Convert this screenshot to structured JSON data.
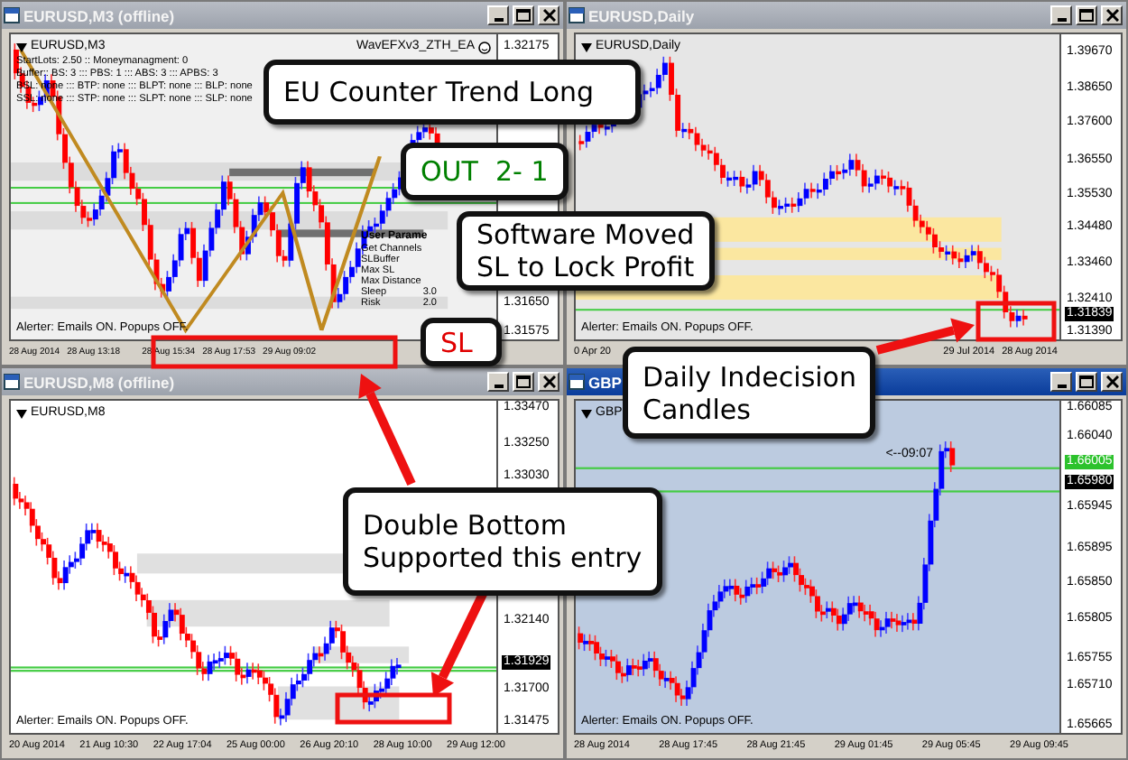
{
  "windows": [
    {
      "title": "EURUSD,M3 (offline)",
      "active": false,
      "kind": "zigzag",
      "symbol": "EURUSD,M3",
      "info_lines": [
        "StartLots: 2.50 :: Moneymanagment: 0",
        "Buffer:: BS: 3 ::: PBS: 1 ::: ABS: 3 ::: APBS: 3",
        "BSL: none ::: BTP: none ::: BLPT: none ::: BLP: none",
        "SSL: none ::: STP: none ::: SLPT: none ::: SLP: none"
      ],
      "ea_label": "WavEFXv3_ZTH_EA",
      "user_params": {
        "title": "User Parame",
        "rows": [
          {
            "label": "Get Channels"
          },
          {
            "label": "SLBuffer"
          },
          {
            "label": "Max SL"
          },
          {
            "label": "Max Distance"
          },
          {
            "label": "Sleep",
            "value": "3.0"
          },
          {
            "label": "Risk",
            "value": "2.0"
          }
        ]
      },
      "alert": "Alerter:  Emails ON.  Popups OFF.",
      "prices": [
        {
          "text": "1.32175",
          "kind": "plain"
        },
        {
          "text": "1.31650",
          "kind": "plain"
        },
        {
          "text": "1.31575",
          "kind": "plain"
        }
      ],
      "times": [
        "28 Aug 2014",
        "28 Aug 13:18",
        "28 Aug 15:34",
        "28 Aug 17:53",
        "29 Aug 09:02"
      ]
    },
    {
      "title": "EURUSD,Daily",
      "active": false,
      "kind": "daily",
      "symbol": "EURUSD,Daily",
      "alert": "Alerter:  Emails ON.  Popups OFF.",
      "prices": [
        {
          "text": "1.39670",
          "kind": "plain"
        },
        {
          "text": "1.38650",
          "kind": "plain"
        },
        {
          "text": "1.37600",
          "kind": "plain"
        },
        {
          "text": "1.36550",
          "kind": "plain"
        },
        {
          "text": "1.35530",
          "kind": "plain"
        },
        {
          "text": "1.34480",
          "kind": "plain"
        },
        {
          "text": "1.33460",
          "kind": "plain"
        },
        {
          "text": "1.32410",
          "kind": "plain"
        },
        {
          "text": "1.31839",
          "kind": "current"
        },
        {
          "text": "1.31390",
          "kind": "plain"
        }
      ],
      "times": [
        "0 Apr 20",
        "29 Jul 2014",
        "28 Aug 2014"
      ]
    },
    {
      "title": "EURUSD,M8 (offline)",
      "active": false,
      "kind": "renko",
      "symbol": "EURUSD,M8",
      "alert": "Alerter:  Emails ON.  Popups OFF.",
      "prices": [
        {
          "text": "1.33470",
          "kind": "plain"
        },
        {
          "text": "1.33250",
          "kind": "plain"
        },
        {
          "text": "1.33030",
          "kind": "plain"
        },
        {
          "text": "1.32140",
          "kind": "plain"
        },
        {
          "text": "1.31929",
          "kind": "current"
        },
        {
          "text": "1.31700",
          "kind": "plain"
        },
        {
          "text": "1.31475",
          "kind": "plain"
        }
      ],
      "times": [
        "20 Aug 2014",
        "21 Aug 10:30",
        "22 Aug 17:04",
        "25 Aug 00:00",
        "26 Aug 20:10",
        "28 Aug 10:00",
        "29 Aug 12:00"
      ]
    },
    {
      "title": "GBP",
      "active": true,
      "kind": "candles",
      "symbol": "GBP",
      "time_marker": "<--09:07",
      "alert": "Alerter:  Emails ON.  Popups OFF.",
      "prices": [
        {
          "text": "1.66085",
          "kind": "plain"
        },
        {
          "text": "1.66040",
          "kind": "plain"
        },
        {
          "text": "1.66005",
          "kind": "bid"
        },
        {
          "text": "1.65980",
          "kind": "current"
        },
        {
          "text": "1.65945",
          "kind": "plain"
        },
        {
          "text": "1.65895",
          "kind": "plain"
        },
        {
          "text": "1.65850",
          "kind": "plain"
        },
        {
          "text": "1.65805",
          "kind": "plain"
        },
        {
          "text": "1.65755",
          "kind": "plain"
        },
        {
          "text": "1.65710",
          "kind": "plain"
        },
        {
          "text": "1.65665",
          "kind": "plain"
        }
      ],
      "times": [
        "28 Aug 2014",
        "28 Aug 17:45",
        "28 Aug 21:45",
        "29 Aug 01:45",
        "29 Aug 05:45",
        "29 Aug 09:45"
      ]
    }
  ],
  "callouts": [
    {
      "lines": [
        "EU Counter Trend Long"
      ],
      "color": "#000000"
    },
    {
      "lines": [
        "OUT  2- 1"
      ],
      "color": "#008000"
    },
    {
      "lines": [
        "Software Moved",
        "SL to Lock Profit"
      ],
      "color": "#000000"
    },
    {
      "lines": [
        "SL"
      ],
      "color": "#e00000"
    },
    {
      "lines": [
        "Daily Indecision",
        "Candles"
      ],
      "color": "#000000"
    },
    {
      "lines": [
        "Double Bottom",
        "Supported this entry"
      ],
      "color": "#000000"
    }
  ]
}
